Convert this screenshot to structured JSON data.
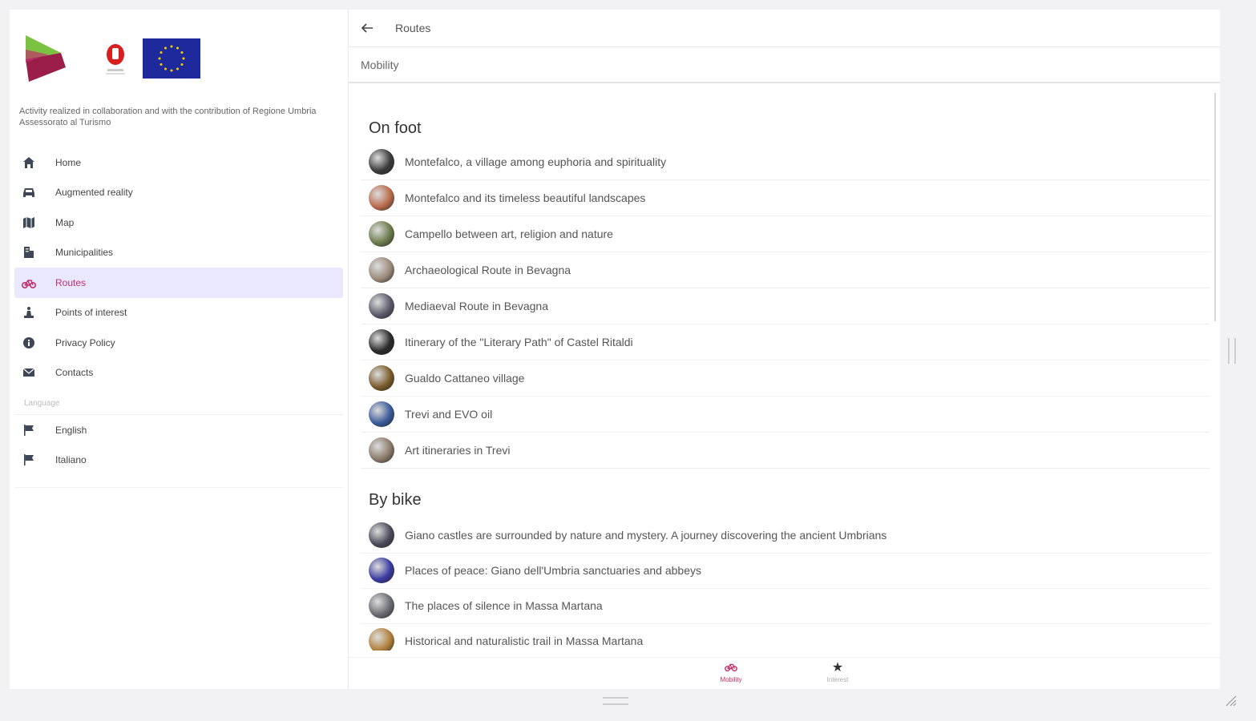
{
  "sidebar": {
    "credit": "Activity realized in collaboration and with the contribution of Regione Umbria Assessorato al Turismo",
    "items": [
      {
        "label": "Home",
        "icon": "home-icon"
      },
      {
        "label": "Augmented reality",
        "icon": "car-icon"
      },
      {
        "label": "Map",
        "icon": "map-icon"
      },
      {
        "label": "Municipalities",
        "icon": "building-icon"
      },
      {
        "label": "Routes",
        "icon": "bike-icon",
        "active": true
      },
      {
        "label": "Points of interest",
        "icon": "monument-icon"
      },
      {
        "label": "Privacy Policy",
        "icon": "info-icon"
      },
      {
        "label": "Contacts",
        "icon": "mail-icon"
      }
    ],
    "language_header": "Language",
    "languages": [
      {
        "label": "English",
        "icon": "flag-icon"
      },
      {
        "label": "Italiano",
        "icon": "flag-icon"
      }
    ]
  },
  "topbar": {
    "title": "Routes"
  },
  "subbar": {
    "title": "Mobility"
  },
  "sections": [
    {
      "title": "On foot",
      "routes": [
        {
          "label": "Montefalco, a village among euphoria and spirituality",
          "color": "#3a3a3a"
        },
        {
          "label": "Montefalco and its timeless beautiful landscapes",
          "color": "#b86a4a"
        },
        {
          "label": "Campello between art, religion and nature",
          "color": "#6a7a4a"
        },
        {
          "label": "Archaeological Route in Bevagna",
          "color": "#9a8a7a"
        },
        {
          "label": "Mediaeval Route in Bevagna",
          "color": "#5a5a6a"
        },
        {
          "label": "Itinerary of the \"Literary Path\" of Castel Ritaldi",
          "color": "#2a2a2a"
        },
        {
          "label": "Gualdo Cattaneo village",
          "color": "#7a5a2a"
        },
        {
          "label": "Trevi and EVO oil",
          "color": "#3a5a9a"
        },
        {
          "label": "Art itineraries in Trevi",
          "color": "#8a7a6a"
        }
      ]
    },
    {
      "title": "By bike",
      "routes": [
        {
          "label": "Giano castles are surrounded by nature and mystery. A journey discovering the ancient Umbrians",
          "color": "#4a4a5a"
        },
        {
          "label": "Places of peace: Giano dell'Umbria sanctuaries and abbeys",
          "color": "#3a3aa0"
        },
        {
          "label": "The places of silence in Massa Martana",
          "color": "#6a6a72"
        },
        {
          "label": "Historical and naturalistic trail in Massa Martana",
          "color": "#b0803a"
        }
      ]
    }
  ],
  "bottom_nav": [
    {
      "label": "Mobility",
      "icon": "bike-icon",
      "active": true
    },
    {
      "label": "Interest",
      "icon": "star-icon",
      "active": false
    }
  ],
  "colors": {
    "accent": "#c0306a",
    "active_bg": "#e9e8ff",
    "eu_blue": "#1e2a9b"
  }
}
